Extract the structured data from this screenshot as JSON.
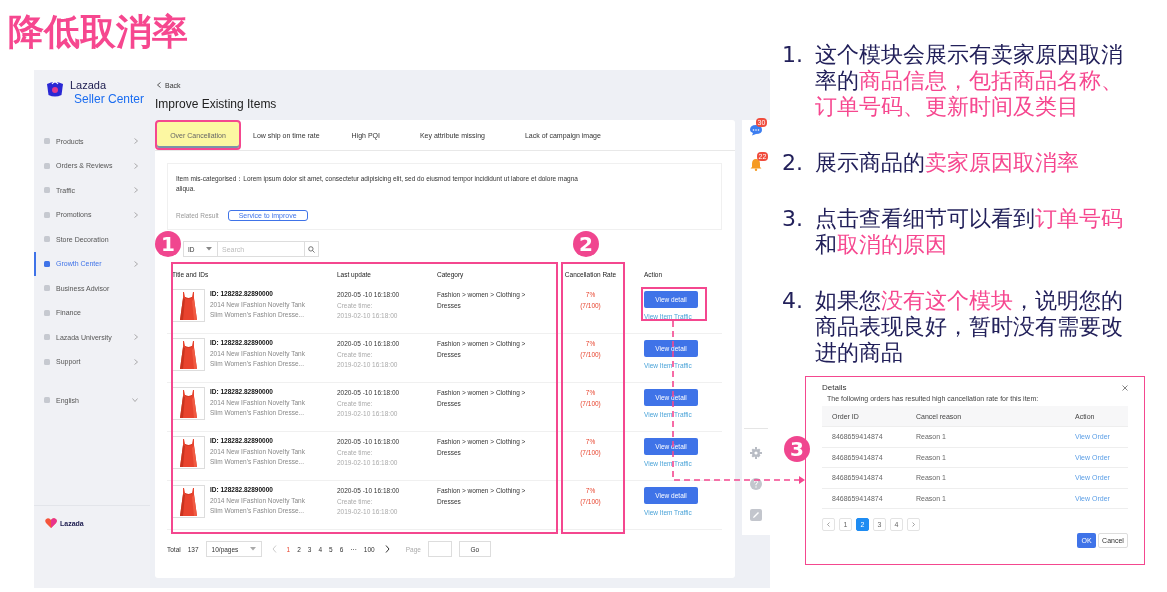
{
  "slide_title": "降低取消率",
  "app": {
    "brand": {
      "name": "Lazada",
      "product": "Seller Center"
    },
    "sidebar": {
      "items": [
        {
          "label": "Products",
          "selected": false,
          "expandable": true
        },
        {
          "label": "Orders & Reviews",
          "selected": false,
          "expandable": true
        },
        {
          "label": "Traffic",
          "selected": false,
          "expandable": true
        },
        {
          "label": "Promotions",
          "selected": false,
          "expandable": true
        },
        {
          "label": "Store Decoration",
          "selected": false,
          "expandable": false
        },
        {
          "label": "Growth Center",
          "selected": true,
          "expandable": true
        },
        {
          "label": "Business Advisor",
          "selected": false,
          "expandable": false
        },
        {
          "label": "Finance",
          "selected": false,
          "expandable": false
        },
        {
          "label": "Lazada University",
          "selected": false,
          "expandable": true
        },
        {
          "label": "Support",
          "selected": false,
          "expandable": true
        }
      ],
      "language": "English",
      "footer_brand": "Lazada"
    },
    "back": "Back",
    "page_title": "Improve Existing Items",
    "tabs": [
      {
        "label": "Over Cancellation",
        "selected": true
      },
      {
        "label": "Low ship on time rate",
        "selected": false
      },
      {
        "label": "High PQI",
        "selected": false
      },
      {
        "label": "Key attribute missing",
        "selected": false
      },
      {
        "label": "Lack of campaign image",
        "selected": false
      }
    ],
    "notice": {
      "text": "Item mis-categorised：Lorem ipsum dolor sit amet, consectetur adipisicing elit, sed do eiusmod tempor incididunt ut labore et dolore magna aliqua.",
      "related_label": "Related Result",
      "related_button": "Service to improve"
    },
    "filter": {
      "field": "ID",
      "search_placeholder": "Search"
    },
    "table": {
      "columns": [
        "Title and IDs",
        "Last update",
        "Category",
        "Cancellation Rate",
        "Action"
      ],
      "rows": [
        {
          "id": "ID: 128282.82890000",
          "title": "2014 New IFashion Novelty Tank Slim Women's Fashion Dresse...",
          "updated": "2020-05 -10  16:18:00",
          "create_label": "Create time:",
          "created": "2019-02-10  16:18:00",
          "category": "Fashion > women > Clothing > Dresses",
          "rate": "7%",
          "rate_count": "(7/100)",
          "button": "View detail",
          "link": "View Item Traffic"
        },
        {
          "id": "ID: 128282.82890000",
          "title": "2014 New IFashion Novelty Tank Slim Women's Fashion Dresse...",
          "updated": "2020-05 -10  16:18:00",
          "create_label": "Create time:",
          "created": "2019-02-10  16:18:00",
          "category": "Fashion > women > Clothing > Dresses",
          "rate": "7%",
          "rate_count": "(7/100)",
          "button": "View detail",
          "link": "View Item Traffic"
        },
        {
          "id": "ID: 128282.82890000",
          "title": "2014 New IFashion Novelty Tank Slim Women's Fashion Dresse...",
          "updated": "2020-05 -10  16:18:00",
          "create_label": "Create time:",
          "created": "2019-02-10  16:18:00",
          "category": "Fashion > women > Clothing > Dresses",
          "rate": "7%",
          "rate_count": "(7/100)",
          "button": "View detail",
          "link": "View Item Traffic"
        },
        {
          "id": "ID: 128282.82890000",
          "title": "2014 New IFashion Novelty Tank Slim Women's Fashion Dresse...",
          "updated": "2020-05 -10  16:18:00",
          "create_label": "Create time:",
          "created": "2019-02-10  16:18:00",
          "category": "Fashion > women > Clothing > Dresses",
          "rate": "7%",
          "rate_count": "(7/100)",
          "button": "View detail",
          "link": "View Item Traffic"
        },
        {
          "id": "ID: 128282.82890000",
          "title": "2014 New IFashion Novelty Tank Slim Women's Fashion Dresse...",
          "updated": "2020-05 -10  16:18:00",
          "create_label": "Create time:",
          "created": "2019-02-10  16:18:00",
          "category": "Fashion > women > Clothing > Dresses",
          "rate": "7%",
          "rate_count": "(7/100)",
          "button": "View detail",
          "link": "View Item Traffic"
        }
      ]
    },
    "pagination": {
      "total_label": "Total",
      "total": "137",
      "page_size": "10/pages",
      "pages": [
        {
          "label": "1",
          "selected": true
        },
        {
          "label": "2",
          "selected": false
        },
        {
          "label": "3",
          "selected": false
        },
        {
          "label": "4",
          "selected": false
        },
        {
          "label": "5",
          "selected": false
        },
        {
          "label": "6",
          "selected": false
        },
        {
          "label": "···",
          "selected": false
        },
        {
          "label": "100",
          "selected": false
        }
      ],
      "page_label": "Page",
      "go": "Go"
    },
    "rail": {
      "chat_badge": "30",
      "bell_badge": "22"
    }
  },
  "dialog": {
    "title": "Details",
    "subtitle": "The following orders has resulted high cancellation rate for this item:",
    "columns": [
      "Order ID",
      "Cancel reason",
      "Action"
    ],
    "rows": [
      {
        "order_id": "8468659414874",
        "reason": "Reason 1",
        "action": "View Order"
      },
      {
        "order_id": "8468659414874",
        "reason": "Reason 1",
        "action": "View Order"
      },
      {
        "order_id": "8468659414874",
        "reason": "Reason 1",
        "action": "View Order"
      },
      {
        "order_id": "8468659414874",
        "reason": "Reason 1",
        "action": "View Order"
      }
    ],
    "pages": [
      {
        "label": "1",
        "selected": false
      },
      {
        "label": "2",
        "selected": true
      },
      {
        "label": "3",
        "selected": false
      },
      {
        "label": "4",
        "selected": false
      }
    ],
    "ok": "OK",
    "cancel": "Cancel"
  },
  "notes": [
    {
      "number": "1.",
      "parts": [
        {
          "text": "这个模块会展示有卖家原因取消率的",
          "highlight": false
        },
        {
          "text": "商品信息，包括商品名称、订单号码、更新时间及类目",
          "highlight": true
        }
      ]
    },
    {
      "number": "2.",
      "parts": [
        {
          "text": "展示商品的",
          "highlight": false
        },
        {
          "text": "卖家原因取消率",
          "highlight": true
        }
      ]
    },
    {
      "number": "3.",
      "parts": [
        {
          "text": "点击查看细节可以看到",
          "highlight": false
        },
        {
          "text": "订单号码",
          "highlight": true
        },
        {
          "text": "和",
          "highlight": false
        },
        {
          "text": "取消的原因",
          "highlight": true
        }
      ]
    },
    {
      "number": "4.",
      "parts": [
        {
          "text": "如果您",
          "highlight": false
        },
        {
          "text": "没有这个模块",
          "highlight": true
        },
        {
          "text": "，说明您的商品表现良好，暂时没有需要改进的商品",
          "highlight": false
        }
      ]
    }
  ],
  "steps": [
    "1",
    "2",
    "3"
  ]
}
